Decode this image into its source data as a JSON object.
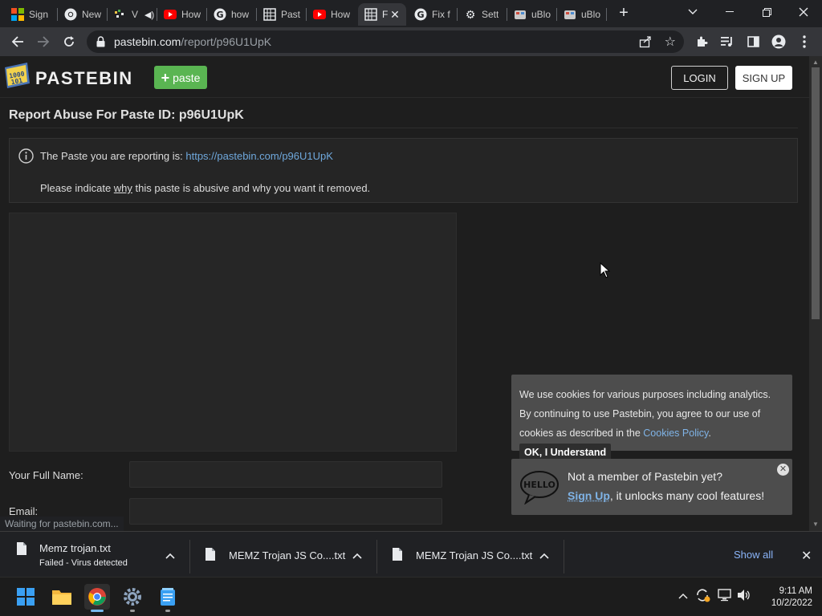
{
  "browser": {
    "tabs": [
      {
        "title": "Sign",
        "icon": "windows-logo-icon"
      },
      {
        "title": "New",
        "icon": "chrome-icon"
      },
      {
        "title": "V",
        "icon": "game-icon"
      },
      {
        "title": "How",
        "icon": "youtube-icon"
      },
      {
        "title": "how",
        "icon": "google-icon"
      },
      {
        "title": "Past",
        "icon": "pastebin-icon"
      },
      {
        "title": "How",
        "icon": "youtube-icon"
      },
      {
        "title": "F",
        "icon": "pastebin-icon",
        "active": true
      },
      {
        "title": "Fix f",
        "icon": "google-icon"
      },
      {
        "title": "Sett",
        "icon": "settings-icon"
      },
      {
        "title": "uBlo",
        "icon": "ublock-icon"
      },
      {
        "title": "uBlo",
        "icon": "ublock-icon"
      }
    ],
    "new_tab_label": "+",
    "url_host": "pastebin.com",
    "url_path": "/report/p96U1UpK",
    "status_text": "Waiting for pastebin.com..."
  },
  "page": {
    "logo_text": "PASTEBIN",
    "new_paste_label": "paste",
    "login_label": "LOGIN",
    "signup_label": "SIGN UP",
    "title": "Report Abuse For Paste ID: p96U1UpK",
    "info_prefix": "The Paste you are reporting is: ",
    "info_link": "https://pastebin.com/p96U1UpK",
    "instruction_pre": "Please indicate ",
    "instruction_why": "why",
    "instruction_post": " this paste is abusive and why you want it removed.",
    "full_name_label": "Your Full Name:",
    "email_label": "Email:",
    "full_name_value": "",
    "email_value": ""
  },
  "cookie_notice": {
    "text_pre": "We use cookies for various purposes including analytics. By continuing to use Pastebin, you agree to our use of cookies as described in the ",
    "policy_link": "Cookies Policy",
    "text_post": ".",
    "ok_label": "OK, I Understand"
  },
  "member_promo": {
    "line1": "Not a member of Pastebin yet?",
    "signup_link": "Sign Up",
    "line2_rest": ", it unlocks many cool features!",
    "hello_text": "HELLO"
  },
  "downloads": {
    "items": [
      {
        "name": "Memz trojan.txt",
        "status": "Failed - Virus detected"
      },
      {
        "name": "MEMZ Trojan JS Co....txt",
        "status": ""
      },
      {
        "name": "MEMZ Trojan JS Co....txt",
        "status": ""
      }
    ],
    "show_all_label": "Show all"
  },
  "taskbar": {
    "apps": [
      "start-icon",
      "file-explorer-icon",
      "chrome-icon",
      "settings-icon",
      "notepad-icon"
    ],
    "time": "9:11 AM",
    "date": "10/2/2022"
  },
  "colors": {
    "pastebin_green": "#5ab552",
    "link_blue": "#6fa8dc",
    "page_bg": "#1e1e1e"
  }
}
